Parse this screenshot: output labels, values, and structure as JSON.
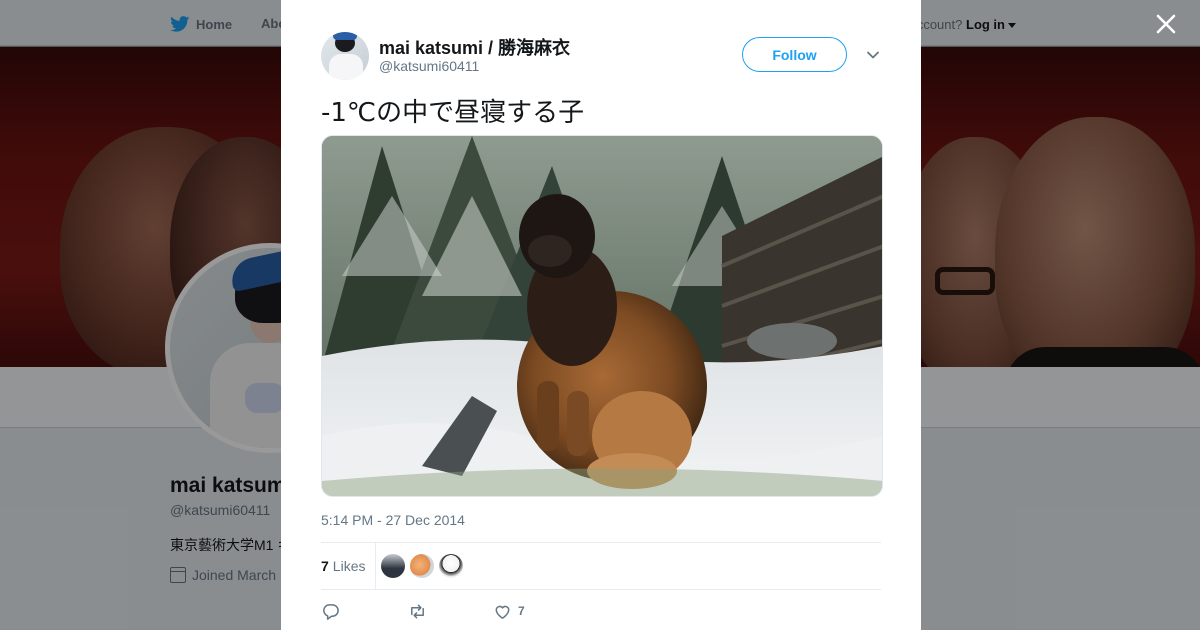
{
  "background_page": {
    "nav": {
      "home_label": "Home",
      "about_label": "Abo"
    },
    "login": {
      "prompt": "ccount?",
      "login_label": "Log in"
    },
    "profile": {
      "name": "mai katsum",
      "handle": "@katsumi60411",
      "bio": "東京藝術大学M1 キ",
      "joined": "Joined March"
    }
  },
  "tweet": {
    "author": {
      "name": "mai katsumi / 勝海麻衣",
      "handle": "@katsumi60411"
    },
    "follow_label": "Follow",
    "text": "-1℃の中で昼寝する子",
    "timestamp": "5:14 PM - 27 Dec 2014",
    "likes": {
      "count": "7",
      "label": "Likes"
    },
    "actions": {
      "reply_count": "",
      "retweet_count": "",
      "like_count": "7"
    }
  },
  "colors": {
    "brand": "#1da1f2",
    "secondary_text": "#657786",
    "primary_text": "#14171a"
  },
  "icons": {
    "top_nav": "twitter-bird-icon",
    "close": "close-icon",
    "menu": "chevron-down-icon",
    "joined": "calendar-icon",
    "reply": "reply-icon",
    "retweet": "retweet-icon",
    "like": "heart-icon"
  }
}
